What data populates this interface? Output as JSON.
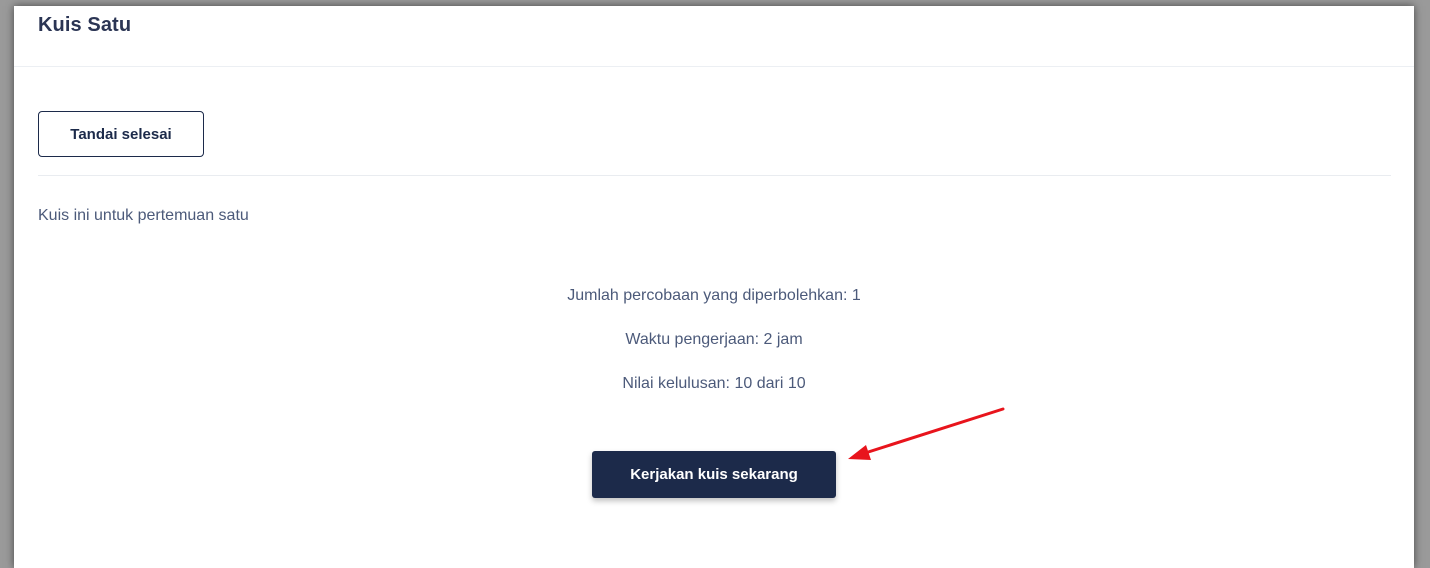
{
  "page": {
    "title": "Kuis Satu"
  },
  "actions": {
    "mark_done_label": "Tandai selesai",
    "start_quiz_label": "Kerjakan kuis sekarang"
  },
  "quiz": {
    "description": "Kuis ini untuk pertemuan satu",
    "attempts_allowed": "Jumlah percobaan yang diperbolehkan: 1",
    "duration": "Waktu pengerjaan: 2 jam",
    "passing_grade": "Nilai kelulusan: 10 dari 10"
  },
  "colors": {
    "primary": "#1c2a4a",
    "annotation_arrow": "#e8141c"
  },
  "icons": {
    "annotation": "red-arrow-icon"
  }
}
